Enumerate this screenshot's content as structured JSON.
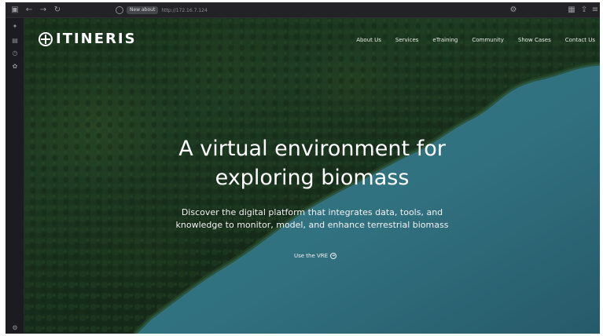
{
  "browser": {
    "address_chip": "New about",
    "url": "http://172.16.7.124"
  },
  "site": {
    "logo_text": "ITINERIS",
    "nav": [
      {
        "label": "About Us"
      },
      {
        "label": "Services"
      },
      {
        "label": "eTraining"
      },
      {
        "label": "Community"
      },
      {
        "label": "Show Cases"
      },
      {
        "label": "Contact Us"
      }
    ]
  },
  "hero": {
    "headline_line1": "A virtual environment for",
    "headline_line2": "exploring biomass",
    "subtitle_line1": "Discover the digital platform that integrates data, tools, and",
    "subtitle_line2": "knowledge to monitor, model, and enhance terrestrial biomass",
    "cta_label": "Use the VRE"
  },
  "colors": {
    "forest": "#1f3d24",
    "water": "#3e8fa0",
    "text": "#ffffff"
  }
}
